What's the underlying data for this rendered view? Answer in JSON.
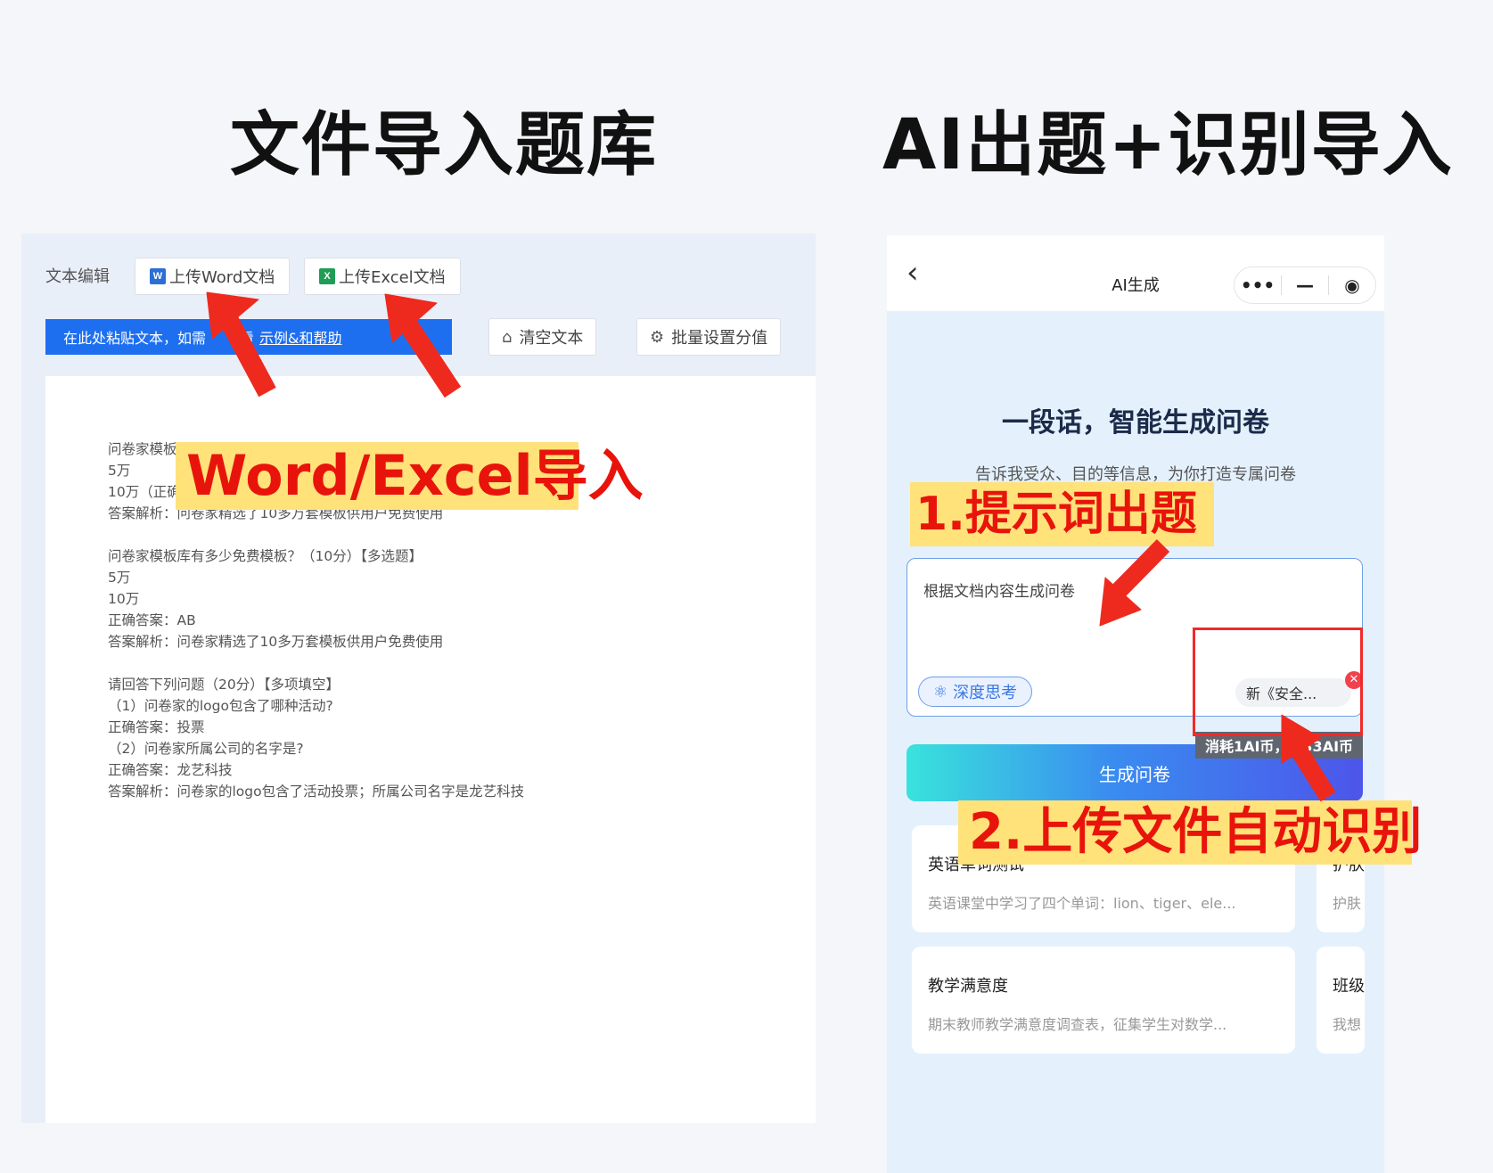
{
  "headings": {
    "left": "文件导入题库",
    "right": "AI出题+识别导入"
  },
  "left_panel": {
    "toolbar": {
      "label": "文本编辑",
      "upload_word": "上传Word文档",
      "upload_excel": "上传Excel文档"
    },
    "hint_bar": {
      "prefix": "在此处粘贴文本，如需",
      "middle": "看",
      "link": "示例&和帮助"
    },
    "clear_button": "清空文本",
    "batch_score_button": "批量设置分值",
    "editor_lines": [
      "问卷家模板",
      "5万",
      "10万（正确",
      "答案解析：问卷家精选了10多万套模板供用户免费使用",
      "问卷家模板库有多少免费模板？（10分）【多选题】",
      "5万",
      "10万",
      "正确答案：AB",
      "答案解析：问卷家精选了10多万套模板供用户免费使用",
      "请回答下列问题（20分）【多项填空】",
      "（1）问卷家的logo包含了哪种活动?",
      "正确答案：投票",
      "（2）问卷家所属公司的名字是?",
      "正确答案：龙艺科技",
      "答案解析：问卷家的logo包含了活动投票；所属公司名字是龙艺科技"
    ],
    "callout": "Word/Excel导入"
  },
  "right_panel": {
    "header": {
      "title": "AI生成",
      "capsule_more": "•••",
      "capsule_min": "—",
      "capsule_close": "◉"
    },
    "heading": "一段话，智能生成问卷",
    "subheading": "告诉我受众、目的等信息，为你打造专属问卷",
    "callout_1": "1.提示词出题",
    "prompt_text": "根据文档内容生成问卷",
    "deep_think": "深度思考",
    "file_chip": "新《安全...",
    "cost_tag": "消耗1AI币，剩33AI币",
    "generate_button": "生成问卷",
    "callout_2": "2.上传文件自动识别",
    "cards": [
      {
        "title": "英语单词测试",
        "desc": "英语课堂中学习了四个单词：lion、tiger、ele..."
      },
      {
        "title": "护肤",
        "desc": "护肤"
      },
      {
        "title": "教学满意度",
        "desc": "期末教师教学满意度调查表，征集学生对数学..."
      },
      {
        "title": "班级",
        "desc": "我想"
      }
    ]
  }
}
